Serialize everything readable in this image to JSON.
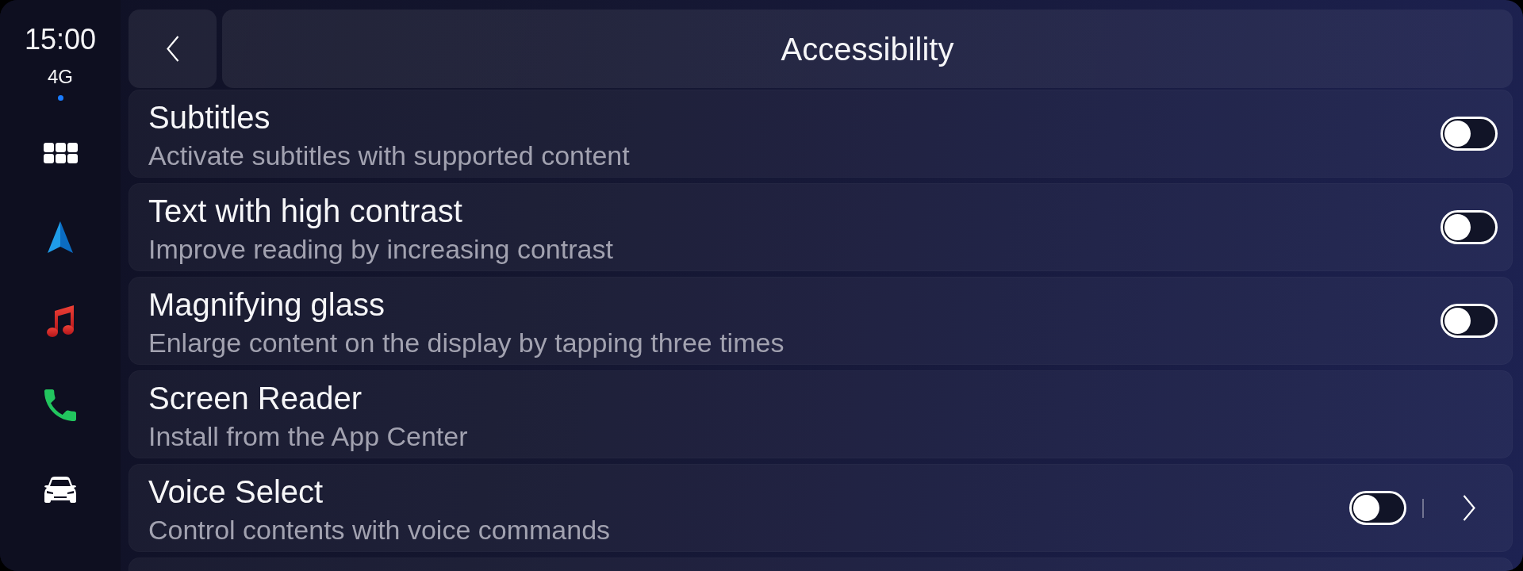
{
  "status": {
    "time": "15:00",
    "network": "4G"
  },
  "header": {
    "title": "Accessibility"
  },
  "settings": [
    {
      "kind": "toggle",
      "title": "Subtitles",
      "description": "Activate subtitles with supported content",
      "on": false
    },
    {
      "kind": "toggle",
      "title": "Text with high contrast",
      "description": "Improve reading by increasing contrast",
      "on": false
    },
    {
      "kind": "toggle",
      "title": "Magnifying glass",
      "description": "Enlarge content on the display by tapping three times",
      "on": false
    },
    {
      "kind": "plain",
      "title": "Screen Reader",
      "description": "Install from the App Center"
    },
    {
      "kind": "toggle_link",
      "title": "Voice Select",
      "description": "Control contents with voice commands",
      "on": false
    }
  ]
}
